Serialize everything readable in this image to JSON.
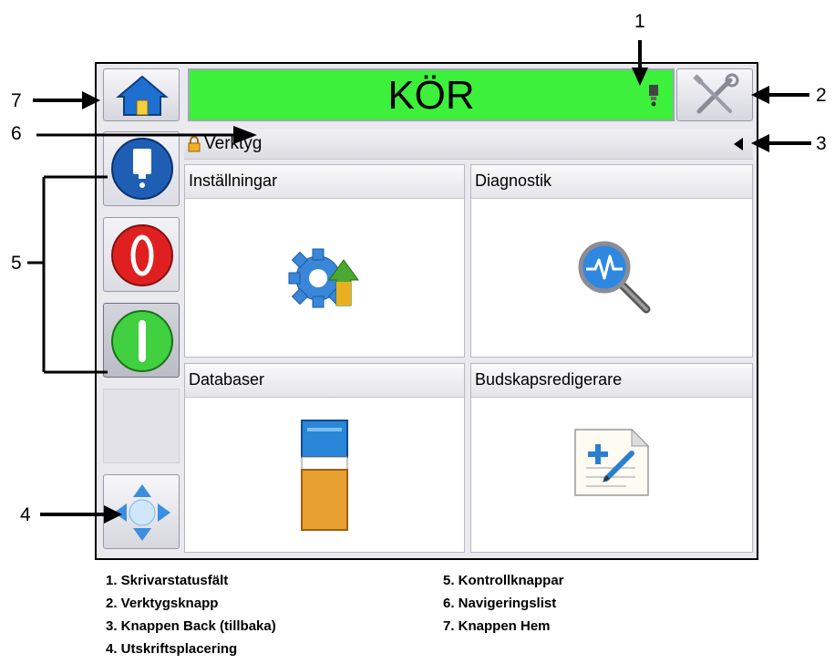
{
  "status_bar": {
    "text": "KÖR"
  },
  "nav": {
    "breadcrumb": "Verktyg"
  },
  "tiles": [
    {
      "label": "Inställningar",
      "icon": "gear-upload-icon"
    },
    {
      "label": "Diagnostik",
      "icon": "magnifier-waveform-icon"
    },
    {
      "label": "Databaser",
      "icon": "file-cabinet-icon"
    },
    {
      "label": "Budskapsredigerare",
      "icon": "document-edit-icon"
    }
  ],
  "callouts": [
    "1",
    "2",
    "3",
    "4",
    "5",
    "6",
    "7"
  ],
  "legend": {
    "col1": [
      "1. Skrivarstatusfält",
      "2. Verktygsknapp",
      "3. Knappen Back (tillbaka)",
      "4. Utskriftsplacering"
    ],
    "col2": [
      "5. Kontrollknappar",
      "6. Navigeringslist",
      "7. Knappen Hem"
    ]
  },
  "colors": {
    "status_running": "#3cf03c",
    "stop_red": "#e02020",
    "start_green": "#40d040",
    "ink_blue": "#1e5fb4",
    "nav_arrow_blue": "#3a8ee0"
  }
}
